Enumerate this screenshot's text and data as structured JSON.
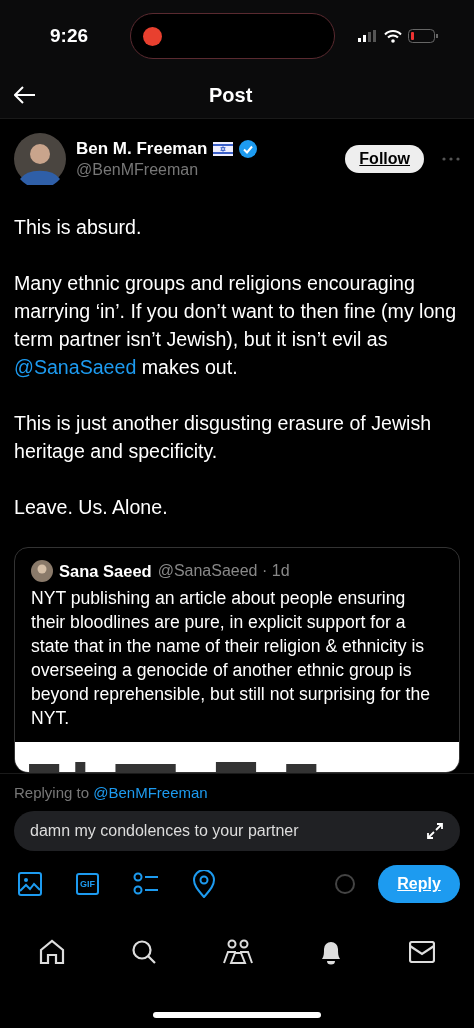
{
  "status_bar": {
    "time": "9:26"
  },
  "header": {
    "title": "Post"
  },
  "post": {
    "author": {
      "name": "Ben M. Freeman",
      "handle": "@BenMFreeman",
      "verified": true
    },
    "follow_label": "Follow",
    "paragraphs": [
      {
        "parts": [
          {
            "text": "This is absurd."
          }
        ]
      },
      {
        "parts": [
          {
            "text": "Many ethnic groups and religions encouraging marrying ‘in’. If you don’t want to then fine (my long term partner isn’t Jewish), but it isn’t evil as "
          },
          {
            "text": "@SanaSaeed",
            "kind": "mention"
          },
          {
            "text": " makes out."
          }
        ]
      },
      {
        "parts": [
          {
            "text": "This is just another disgusting erasure of Jewish heritage and specificity."
          }
        ]
      },
      {
        "parts": [
          {
            "text": "Leave. Us. Alone."
          }
        ]
      }
    ],
    "quote": {
      "name": "Sana Saeed",
      "handle_time": "@SanaSaeed · 1d",
      "text": "NYT publishing an article about people ensuring their bloodlines are pure, in explicit support for a state that in the name of their religion & ethnicity is overseeing a genocide of another ethnic group is beyond reprehensible, but still not surprising for the NYT."
    }
  },
  "reply": {
    "replying_prefix": "Replying to",
    "replying_handle": "@BenMFreeman",
    "value": "damn my condolences to your partner",
    "gif_label": "GIF",
    "button": "Reply"
  },
  "nav": [
    {
      "kind": "home"
    },
    {
      "kind": "search"
    },
    {
      "kind": "communities"
    },
    {
      "kind": "notifications"
    },
    {
      "kind": "messages"
    }
  ]
}
